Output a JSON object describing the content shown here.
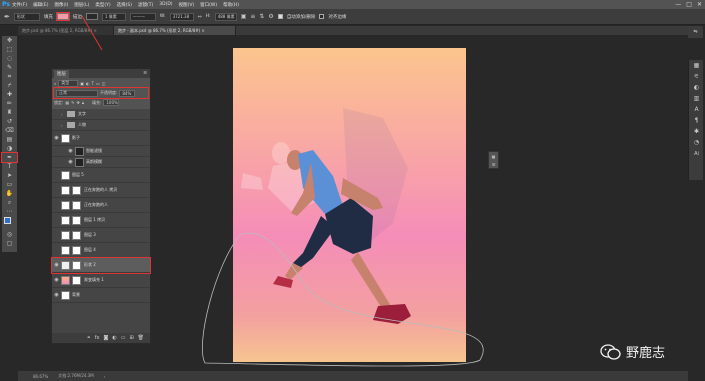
{
  "app": {
    "logo": "Ps"
  },
  "menu": [
    "文件(F)",
    "编辑(E)",
    "图像(I)",
    "图层(L)",
    "类型(Y)",
    "选择(S)",
    "滤镜(T)",
    "3D(D)",
    "视图(V)",
    "窗口(W)",
    "帮助(H)"
  ],
  "window_controls": [
    "—",
    "□",
    "✕"
  ],
  "options": {
    "mode": "形状",
    "fill_label": "填充",
    "fill_color": "#f29ca8",
    "stroke_label": "描边",
    "stroke_width": "1 像素",
    "w_label": "W:",
    "w_value": "3721.38",
    "h_label": "H:",
    "h_value": "488 像素",
    "auto_add": "自动添加/删除",
    "align_edges": "对齐边缘"
  },
  "tabs": [
    {
      "label": "跑步.psd @ 86.7% (图层 2, RGB/8#) ×",
      "active": false
    },
    {
      "label": "跑步 - 副本.psd @ 86.7% (形状 2, RGB/8#) ×",
      "active": true
    }
  ],
  "layers_panel": {
    "tab": "图层",
    "filter": "类型",
    "blend_mode": "正常",
    "opacity_label": "不透明度:",
    "opacity": "84%",
    "lock_label": "锁定:",
    "fill_label": "填充:",
    "fill_value": "100%",
    "layers": [
      {
        "name": "文字",
        "kind": "folder"
      },
      {
        "name": "人物",
        "kind": "folder"
      },
      {
        "name": "影子",
        "kind": "layer",
        "visible": true
      },
      {
        "name": "智能滤镜",
        "kind": "sub",
        "visible": true
      },
      {
        "name": "高斯模糊",
        "kind": "sub",
        "visible": true
      },
      {
        "name": "图层 5",
        "kind": "layer"
      },
      {
        "name": "正在奔跑的人 拷贝",
        "kind": "layer"
      },
      {
        "name": "正在奔跑的人",
        "kind": "layer"
      },
      {
        "name": "图层 1 拷贝",
        "kind": "layer"
      },
      {
        "name": "图层 3",
        "kind": "layer"
      },
      {
        "name": "图层 4",
        "kind": "layer"
      },
      {
        "name": "形状 2",
        "kind": "layer",
        "visible": true,
        "selected": true
      },
      {
        "name": "渐变填充 1",
        "kind": "layer",
        "visible": true
      },
      {
        "name": "背景",
        "kind": "layer",
        "visible": true
      }
    ],
    "footer_icons": [
      "link-icon",
      "fx-icon",
      "mask-icon",
      "adjustment-icon",
      "folder-icon",
      "new-layer-icon",
      "trash-icon"
    ]
  },
  "status": {
    "zoom": "86.67%",
    "doc": "文档:2.76M/24.3M"
  },
  "watermark": {
    "text": "野鹿志"
  },
  "colors": {
    "accent_red": "#e03333",
    "menubar": "#535353",
    "workspace": "#282828"
  }
}
